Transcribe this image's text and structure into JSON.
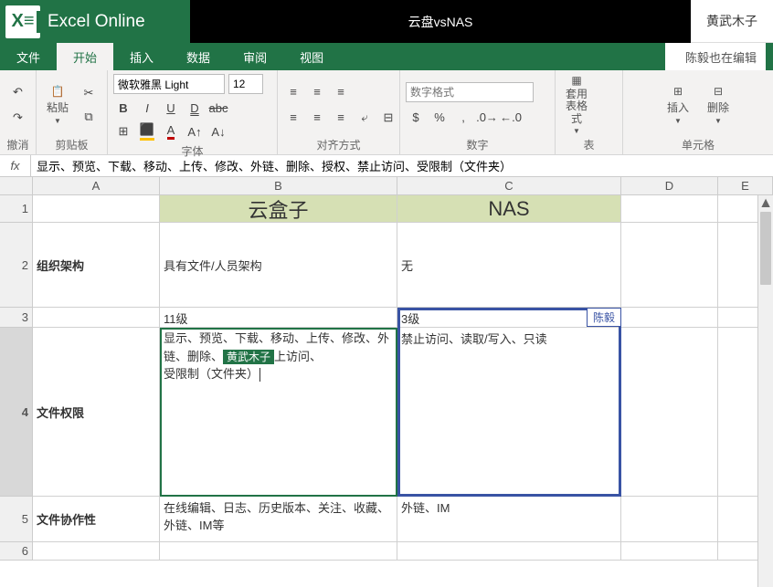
{
  "titlebar": {
    "app_name": "Excel Online",
    "doc_title": "云盘vsNAS",
    "current_user": "黄武木子"
  },
  "tabs": [
    {
      "id": "file",
      "label": "文件"
    },
    {
      "id": "home",
      "label": "开始"
    },
    {
      "id": "insert",
      "label": "插入"
    },
    {
      "id": "data",
      "label": "数据"
    },
    {
      "id": "review",
      "label": "审阅"
    },
    {
      "id": "view",
      "label": "视图"
    }
  ],
  "active_tab": "home",
  "collab_message": "陈毅也在编辑",
  "ribbon": {
    "undo_group": "撤消",
    "clipboard": {
      "paste": "粘贴",
      "group_label": "剪贴板"
    },
    "font": {
      "family": "微软雅黑 Light",
      "size": "12",
      "group_label": "字体"
    },
    "align": {
      "group_label": "对齐方式"
    },
    "number": {
      "format_placeholder": "数字格式",
      "group_label": "数字"
    },
    "table": {
      "button": "套用表格式",
      "group_label": "表"
    },
    "cells": {
      "insert": "插入",
      "delete": "删除",
      "group_label": "单元格"
    }
  },
  "formula": "显示、预览、下载、移动、上传、修改、外链、删除、授权、禁止访问、受限制（文件夹）",
  "columns": [
    "A",
    "B",
    "C",
    "D",
    "E"
  ],
  "row_labels": [
    "1",
    "2",
    "3",
    "4",
    "5",
    "6"
  ],
  "grid": {
    "r1": {
      "B": "云盒子",
      "C": "NAS"
    },
    "r2": {
      "A": "组织架构",
      "B": "具有文件/人员架构",
      "C": "无"
    },
    "r3": {
      "B": "11级",
      "C": "3级"
    },
    "r4": {
      "A": "文件权限",
      "B_pre": "显示、预览、下载、移动、上传、修改、外链、删除、",
      "B_tag": "黄武木子",
      "B_post1": "上访问、",
      "B_post2": "受限制（文件夹）",
      "C": "禁止访问、读取/写入、只读"
    },
    "r5": {
      "A": "文件协作性",
      "B": "在线编辑、日志、历史版本、关注、收藏、外链、IM等",
      "C": "外链、IM"
    }
  },
  "collab_flag": {
    "name": "陈毅"
  },
  "row_heights": {
    "colhead": 20,
    "r1": 30,
    "r2": 93,
    "r3": 22,
    "r4": 185,
    "r5": 50,
    "r6": 20
  }
}
